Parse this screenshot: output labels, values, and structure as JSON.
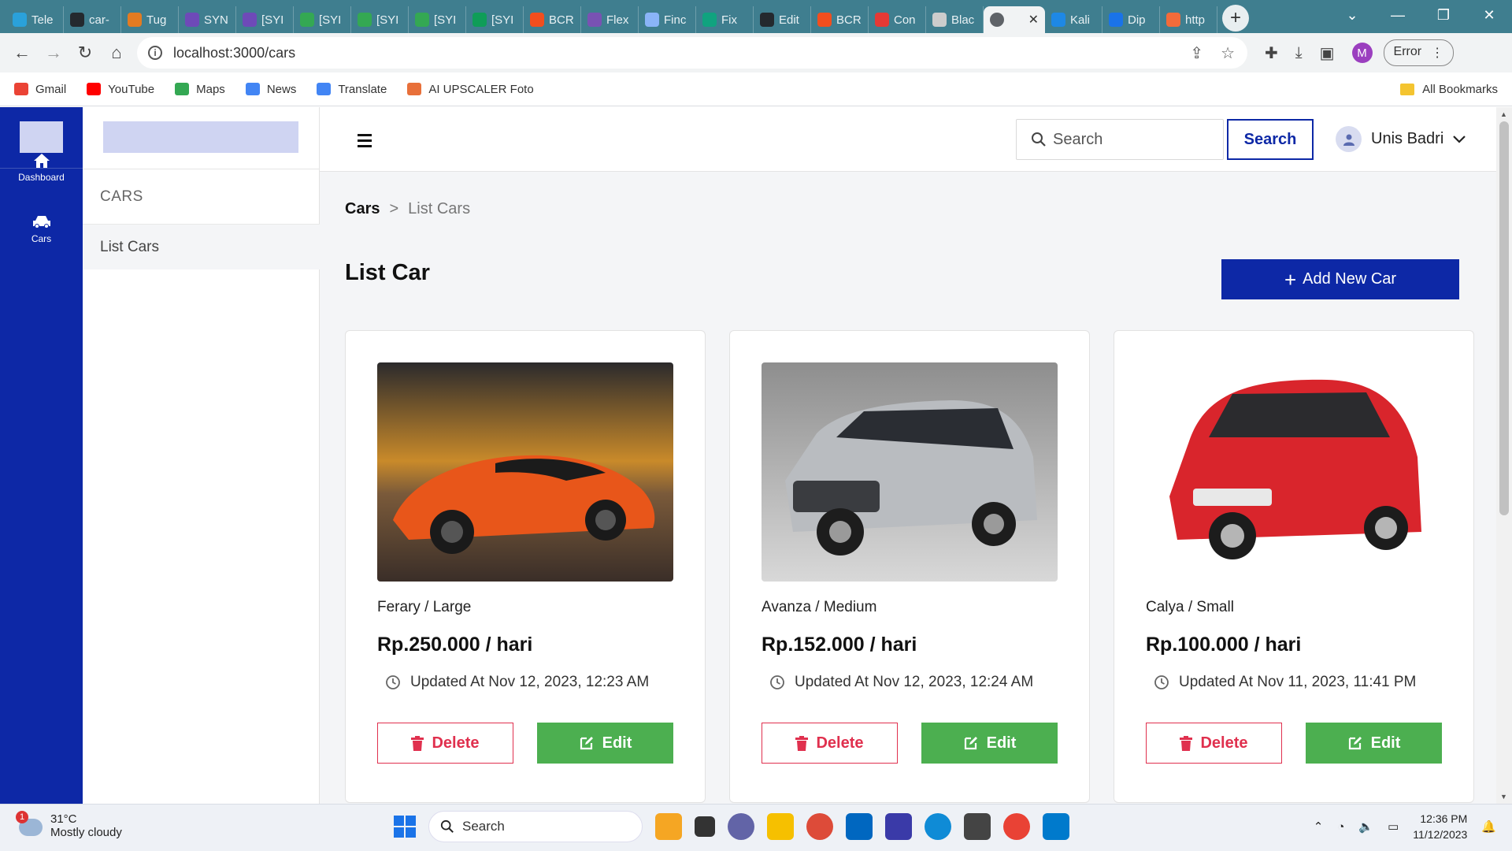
{
  "browser": {
    "tabs": [
      {
        "label": "Tele",
        "color": "#2aa1da"
      },
      {
        "label": "car-",
        "color": "#24292e"
      },
      {
        "label": "Tug",
        "color": "#e37b22"
      },
      {
        "label": "SYN",
        "color": "#6e4ab8"
      },
      {
        "label": "[SYI",
        "color": "#6e4ab8"
      },
      {
        "label": "[SYI",
        "color": "#34a853"
      },
      {
        "label": "[SYI",
        "color": "#34a853"
      },
      {
        "label": "[SYI",
        "color": "#34a853"
      },
      {
        "label": "[SYI",
        "color": "#0f9d58"
      },
      {
        "label": "BCR",
        "color": "#f24e1e"
      },
      {
        "label": "Flex",
        "color": "#7952b3"
      },
      {
        "label": "Finc",
        "color": "#8ab4f8"
      },
      {
        "label": "Fix",
        "color": "#10a37f"
      },
      {
        "label": "Edit",
        "color": "#24292e"
      },
      {
        "label": "BCR",
        "color": "#f24e1e"
      },
      {
        "label": "Con",
        "color": "#e53935"
      },
      {
        "label": "Blac",
        "color": "#cccccc"
      },
      {
        "label": "",
        "color": "#5f6368",
        "active": true
      },
      {
        "label": "Kali",
        "color": "#1e88e5"
      },
      {
        "label": "Dip",
        "color": "#1a73e8"
      },
      {
        "label": "http",
        "color": "#f26b3a"
      }
    ],
    "url": "localhost:3000/cars",
    "profile_initial": "M",
    "error_label": "Error",
    "bookmarks": [
      {
        "label": "Gmail",
        "color": "#ea4335"
      },
      {
        "label": "YouTube",
        "color": "#ff0000"
      },
      {
        "label": "Maps",
        "color": "#34a853"
      },
      {
        "label": "News",
        "color": "#4285f4"
      },
      {
        "label": "Translate",
        "color": "#4285f4"
      },
      {
        "label": "AI UPSCALER Foto",
        "color": "#e8703a"
      }
    ],
    "all_bookmarks": "All Bookmarks"
  },
  "rail": {
    "items": [
      {
        "label": "Dashboard",
        "icon": "home-icon"
      },
      {
        "label": "Cars",
        "icon": "car-icon"
      }
    ]
  },
  "subsidebar": {
    "heading": "CARS",
    "items": [
      {
        "label": "List Cars"
      }
    ]
  },
  "topbar": {
    "search_placeholder": "Search",
    "search_button": "Search",
    "user_name": "Unis Badri"
  },
  "main": {
    "breadcrumb": {
      "root": "Cars",
      "sep": ">",
      "current": "List Cars"
    },
    "title": "List Car",
    "add_button": "Add New Car",
    "cars": [
      {
        "name": "Ferary / Large",
        "price": "Rp.250.000 / hari",
        "updated": "Updated At Nov 12, 2023, 12:23 AM",
        "delete": "Delete",
        "edit": "Edit",
        "body_color": "#e8561a"
      },
      {
        "name": "Avanza / Medium",
        "price": "Rp.152.000 / hari",
        "updated": "Updated At Nov 12, 2023, 12:24 AM",
        "delete": "Delete",
        "edit": "Edit",
        "body_color": "#b9bcc0"
      },
      {
        "name": "Calya / Small",
        "price": "Rp.100.000 / hari",
        "updated": "Updated At Nov 11, 2023, 11:41 PM",
        "delete": "Delete",
        "edit": "Edit",
        "body_color": "#d9252c"
      }
    ]
  },
  "taskbar": {
    "weather_badge": "1",
    "temperature": "31°C",
    "weather_text": "Mostly cloudy",
    "search_label": "Search",
    "time": "12:36 PM",
    "date": "11/12/2023"
  },
  "colors": {
    "primary": "#0d28a6",
    "danger": "#e0304e",
    "success": "#4caf50"
  }
}
